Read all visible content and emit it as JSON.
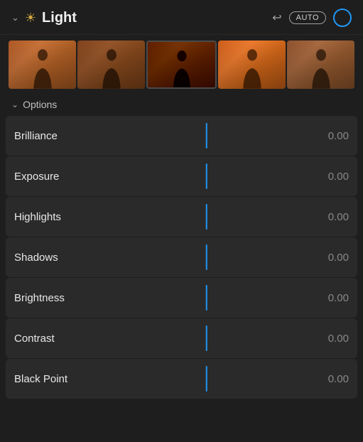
{
  "header": {
    "title": "Light",
    "auto_label": "AUTO",
    "chevron": "chevron-down",
    "sun_icon": "☀",
    "undo_icon": "↩"
  },
  "options": {
    "label": "Options",
    "chevron": "chevron-down"
  },
  "sliders": [
    {
      "id": "brilliance",
      "label": "Brilliance",
      "value": "0.00"
    },
    {
      "id": "exposure",
      "label": "Exposure",
      "value": "0.00"
    },
    {
      "id": "highlights",
      "label": "Highlights",
      "value": "0.00"
    },
    {
      "id": "shadows",
      "label": "Shadows",
      "value": "0.00"
    },
    {
      "id": "brightness",
      "label": "Brightness",
      "value": "0.00"
    },
    {
      "id": "contrast",
      "label": "Contrast",
      "value": "0.00"
    },
    {
      "id": "blackpoint",
      "label": "Black Point",
      "value": "0.00"
    }
  ],
  "filmstrip": {
    "count": 5
  }
}
